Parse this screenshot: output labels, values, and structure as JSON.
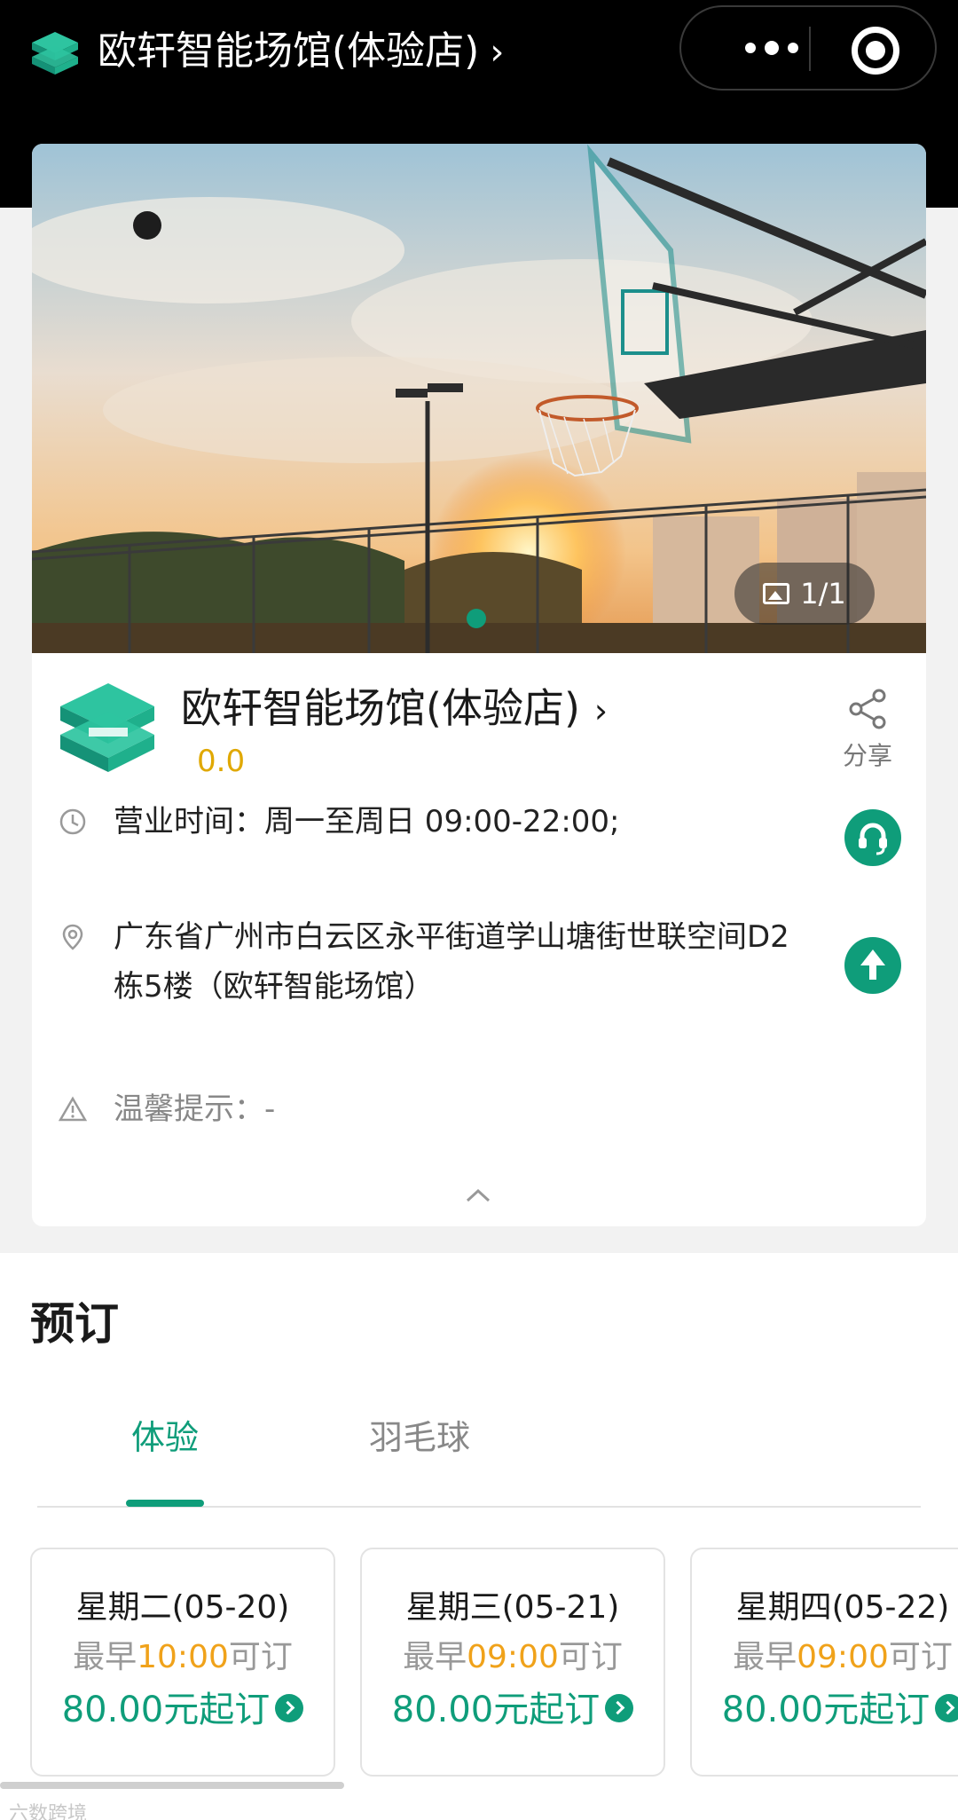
{
  "header": {
    "title": "欧轩智能场馆(体验店)",
    "chevron": "›",
    "more_icon": "more-dots-icon",
    "close_icon": "target-circle-icon"
  },
  "gallery": {
    "counter": "1/1"
  },
  "venue": {
    "name": "欧轩智能场馆(体验店)",
    "chevron": "›",
    "rating": "0.0",
    "share_label": "分享",
    "hours": "营业时间：周一至周日 09:00-22:00;",
    "address": "广东省广州市白云区永平街道学山塘街世联空间D2栋5楼（欧轩智能场馆）",
    "tip": "温馨提示：-"
  },
  "booking": {
    "heading": "预订",
    "tabs": [
      {
        "label": "体验",
        "active": true
      },
      {
        "label": "羽毛球",
        "active": false
      }
    ],
    "days": [
      {
        "date": "星期二(05-20)",
        "earliest_prefix": "最早",
        "time": "10:00",
        "earliest_suffix": "可订",
        "price": "80.00元起订"
      },
      {
        "date": "星期三(05-21)",
        "earliest_prefix": "最早",
        "time": "09:00",
        "earliest_suffix": "可订",
        "price": "80.00元起订"
      },
      {
        "date": "星期四(05-22)",
        "earliest_prefix": "最早",
        "time": "09:00",
        "earliest_suffix": "可订",
        "price": "80.00元起订"
      }
    ]
  },
  "watermark": "六数跨境",
  "colors": {
    "accent": "#0f9d7a",
    "time_highlight": "#f0a21a",
    "rating": "#e0a800"
  }
}
